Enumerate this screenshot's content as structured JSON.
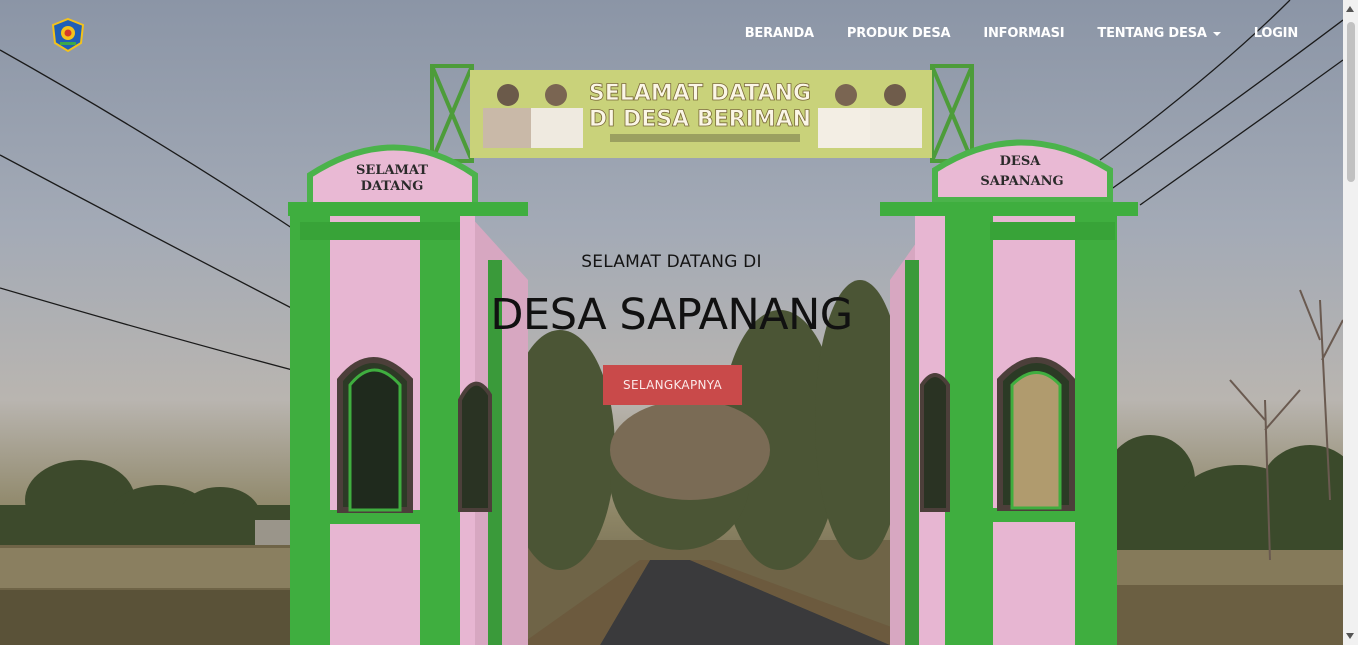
{
  "nav": {
    "logo_icon": "village-emblem-icon",
    "items": [
      {
        "label": "BERANDA"
      },
      {
        "label": "PRODUK DESA"
      },
      {
        "label": "INFORMASI"
      },
      {
        "label": "TENTANG DESA",
        "has_dropdown": true
      },
      {
        "label": "LOGIN"
      }
    ]
  },
  "hero": {
    "subtitle": "SELAMAT DATANG DI",
    "title": "DESA SAPANANG",
    "cta_label": "SELANGKAPNYA",
    "banner": {
      "line1": "SELAMAT DATANG",
      "line2": "DI DESA BERIMAN"
    },
    "left_pillar_sign": [
      "SELAMAT",
      "DATANG"
    ],
    "right_pillar_sign": [
      "DESA",
      "SAPANANG"
    ]
  },
  "colors": {
    "accent": "#c94a4a",
    "gate_green": "#3fae3f",
    "gate_pink": "#e9b9d4",
    "banner_yellow": "#c9d27a"
  }
}
